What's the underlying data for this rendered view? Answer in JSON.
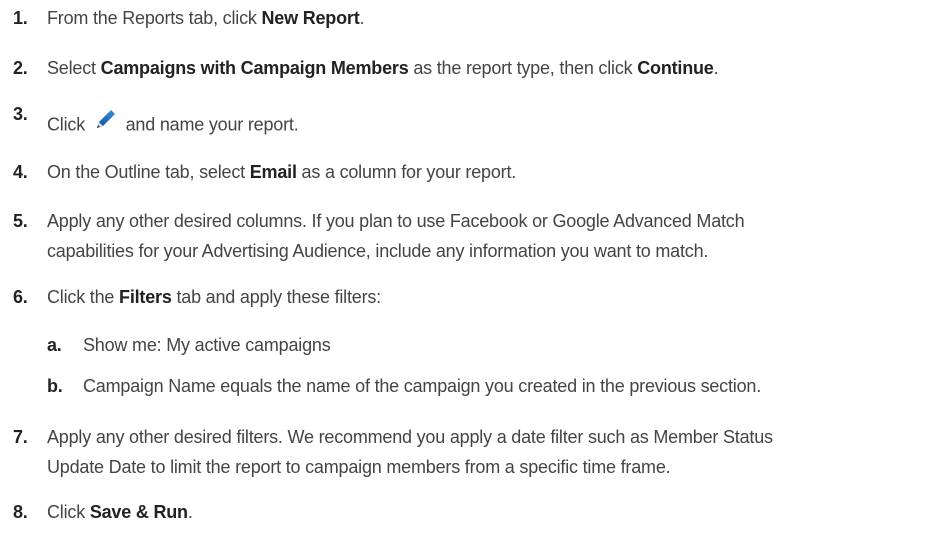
{
  "steps": [
    {
      "num": "1.",
      "pre": "From the Reports tab, click ",
      "bold": "New Report",
      "post": "."
    },
    {
      "num": "2.",
      "pre": "Select ",
      "bold1": "Campaigns with Campaign Members",
      "mid": " as the report type, then click ",
      "bold2": "Continue",
      "post": "."
    },
    {
      "num": "3.",
      "pre": "Click ",
      "icon": "pencil-icon",
      "post": " and name your report."
    },
    {
      "num": "4.",
      "pre": "On the Outline tab, select ",
      "bold": "Email",
      "post": " as a column for your report."
    },
    {
      "num": "5.",
      "line1": "Apply any other desired columns. If you plan to use Facebook or Google Advanced Match",
      "line2": "capabilities for your Advertising Audience, include any information you want to match."
    },
    {
      "num": "6.",
      "pre": "Click the ",
      "bold": "Filters",
      "post": " tab and apply these filters:"
    },
    {
      "num": "a.",
      "text": "Show me: My active campaigns"
    },
    {
      "num": "b.",
      "text": "Campaign Name equals the name of the campaign you created in the previous section."
    },
    {
      "num": "7.",
      "line1": "Apply any other desired filters. We recommend you apply a date filter such as Member Status",
      "line2": "Update Date to limit the report to campaign members from a specific time frame."
    },
    {
      "num": "8.",
      "pre": "Click ",
      "bold": "Save & Run",
      "post": "."
    }
  ],
  "colors": {
    "text": "#444444",
    "bold": "#222222",
    "pencil": "#1b6fc4"
  }
}
